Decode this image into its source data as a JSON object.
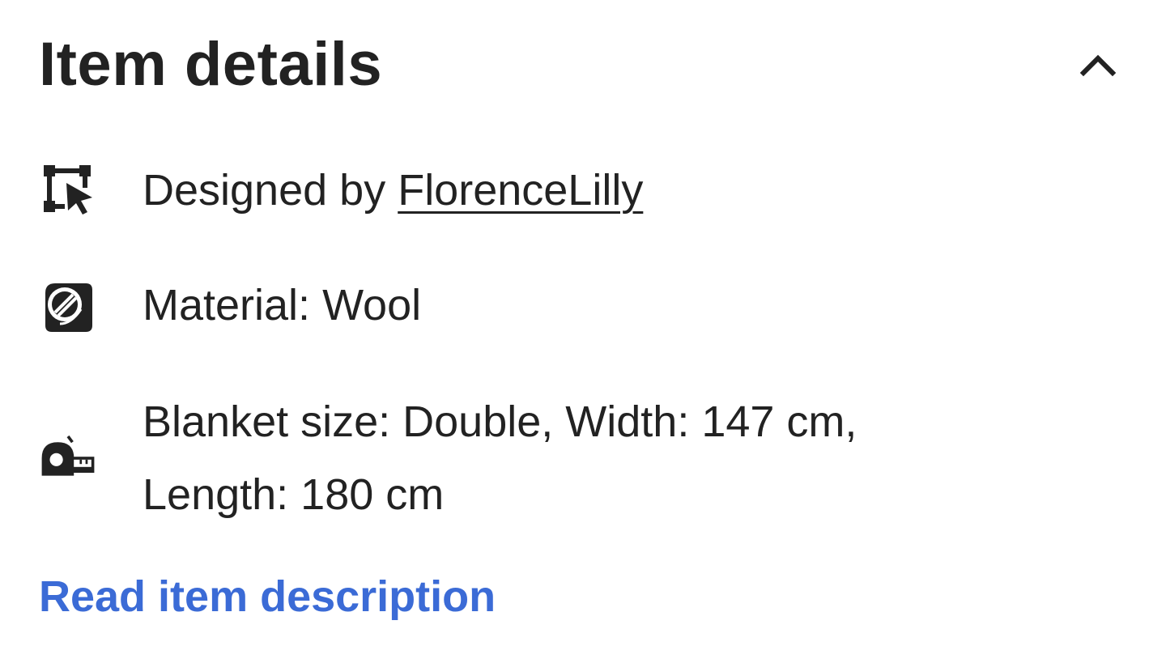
{
  "section": {
    "title": "Item details",
    "collapse_icon": "chevron-up-icon"
  },
  "details": {
    "designer": {
      "icon": "designer-cursor-icon",
      "prefix": "Designed by ",
      "link": "FlorenceLilly"
    },
    "material": {
      "icon": "material-yarn-icon",
      "text": "Material: Wool"
    },
    "size": {
      "icon": "tape-measure-icon",
      "line1": "Blanket size: Double, Width: 147 cm,",
      "line2": "Length: 180 cm"
    }
  },
  "read_description": {
    "label": "Read item description",
    "color": "#3b6bd6"
  }
}
